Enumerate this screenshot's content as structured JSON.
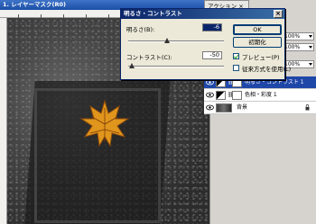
{
  "document": {
    "title": "1. レイヤーマスク(R0)"
  },
  "panel": {
    "actions_tab": "アクション ×",
    "opacity_1": "100%",
    "opacity_2": "100%",
    "fill": "100%"
  },
  "layers": [
    {
      "name": "明るさ・コントラスト 1",
      "selected": true
    },
    {
      "name": "色相・彩度 1",
      "selected": false
    },
    {
      "name": "背景",
      "selected": false
    }
  ],
  "dialog": {
    "title": "明るさ・コントラスト",
    "brightness_label": "明るさ(B):",
    "brightness_value": "-6",
    "contrast_label": "コントラスト(C):",
    "contrast_value": "-50",
    "ok_label": "OK",
    "reset_label": "初期化",
    "preview_label": "プレビュー(P)",
    "preview_checked": true,
    "legacy_label": "従来方式を使用(L)",
    "legacy_checked": false
  }
}
